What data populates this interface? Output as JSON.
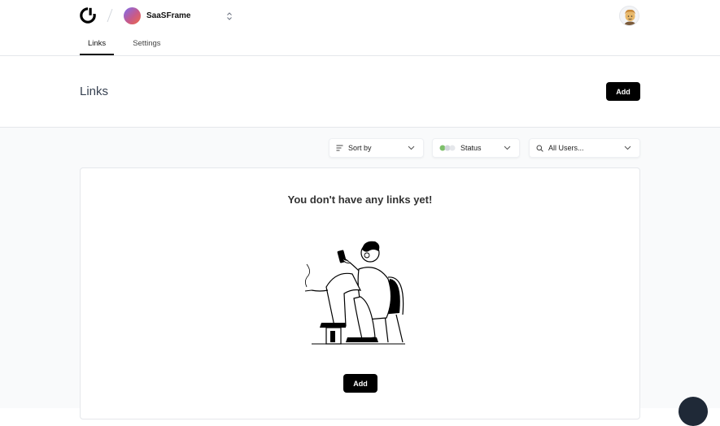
{
  "header": {
    "workspace_name": "SaaSFrame",
    "tabs": [
      {
        "label": "Links",
        "active": true
      },
      {
        "label": "Settings",
        "active": false
      }
    ]
  },
  "page": {
    "title": "Links",
    "add_label": "Add"
  },
  "filters": {
    "sort_label": "Sort by",
    "status_label": "Status",
    "users_label": "All Users..."
  },
  "empty_state": {
    "message": "You don't have any links yet!",
    "add_label": "Add"
  },
  "colors": {
    "primary": "#000000",
    "background": "#f9fafb",
    "border": "#e5e7eb",
    "status_green": "#7dbf6a"
  },
  "icons": {
    "logo": "logo-icon",
    "workspace_switcher": "chevron-updown-icon",
    "sort": "sort-lines-icon",
    "status": "status-dots-icon",
    "search": "search-icon",
    "dropdown": "chevron-down-icon"
  }
}
